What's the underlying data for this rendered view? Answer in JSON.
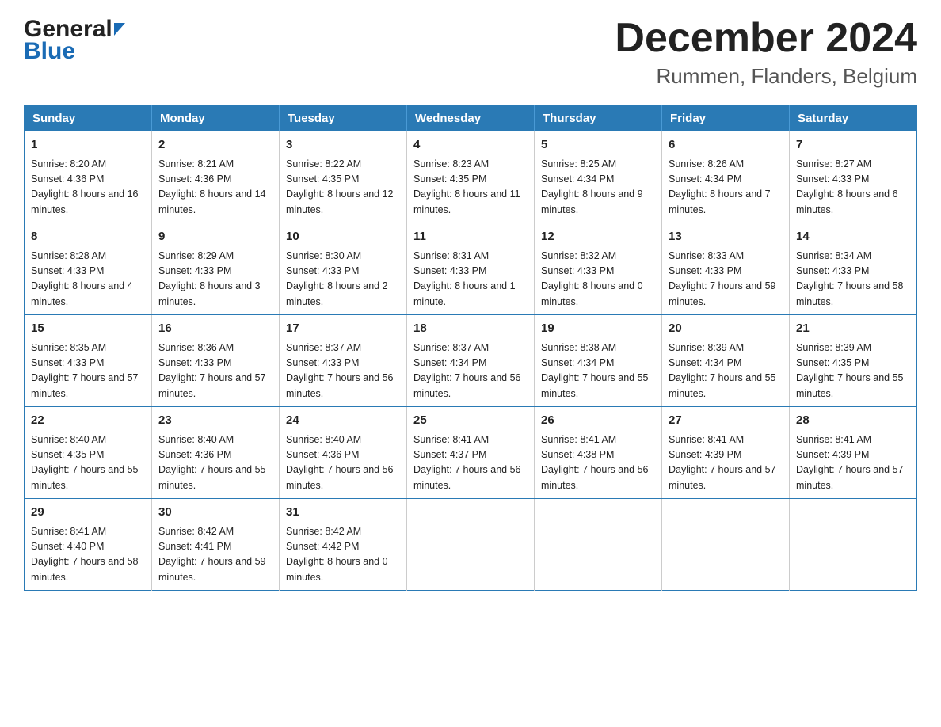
{
  "header": {
    "logo_general": "General",
    "logo_blue": "Blue",
    "month_title": "December 2024",
    "location": "Rummen, Flanders, Belgium"
  },
  "columns": [
    "Sunday",
    "Monday",
    "Tuesday",
    "Wednesday",
    "Thursday",
    "Friday",
    "Saturday"
  ],
  "weeks": [
    [
      {
        "day": "1",
        "sunrise": "8:20 AM",
        "sunset": "4:36 PM",
        "daylight": "8 hours and 16 minutes."
      },
      {
        "day": "2",
        "sunrise": "8:21 AM",
        "sunset": "4:36 PM",
        "daylight": "8 hours and 14 minutes."
      },
      {
        "day": "3",
        "sunrise": "8:22 AM",
        "sunset": "4:35 PM",
        "daylight": "8 hours and 12 minutes."
      },
      {
        "day": "4",
        "sunrise": "8:23 AM",
        "sunset": "4:35 PM",
        "daylight": "8 hours and 11 minutes."
      },
      {
        "day": "5",
        "sunrise": "8:25 AM",
        "sunset": "4:34 PM",
        "daylight": "8 hours and 9 minutes."
      },
      {
        "day": "6",
        "sunrise": "8:26 AM",
        "sunset": "4:34 PM",
        "daylight": "8 hours and 7 minutes."
      },
      {
        "day": "7",
        "sunrise": "8:27 AM",
        "sunset": "4:33 PM",
        "daylight": "8 hours and 6 minutes."
      }
    ],
    [
      {
        "day": "8",
        "sunrise": "8:28 AM",
        "sunset": "4:33 PM",
        "daylight": "8 hours and 4 minutes."
      },
      {
        "day": "9",
        "sunrise": "8:29 AM",
        "sunset": "4:33 PM",
        "daylight": "8 hours and 3 minutes."
      },
      {
        "day": "10",
        "sunrise": "8:30 AM",
        "sunset": "4:33 PM",
        "daylight": "8 hours and 2 minutes."
      },
      {
        "day": "11",
        "sunrise": "8:31 AM",
        "sunset": "4:33 PM",
        "daylight": "8 hours and 1 minute."
      },
      {
        "day": "12",
        "sunrise": "8:32 AM",
        "sunset": "4:33 PM",
        "daylight": "8 hours and 0 minutes."
      },
      {
        "day": "13",
        "sunrise": "8:33 AM",
        "sunset": "4:33 PM",
        "daylight": "7 hours and 59 minutes."
      },
      {
        "day": "14",
        "sunrise": "8:34 AM",
        "sunset": "4:33 PM",
        "daylight": "7 hours and 58 minutes."
      }
    ],
    [
      {
        "day": "15",
        "sunrise": "8:35 AM",
        "sunset": "4:33 PM",
        "daylight": "7 hours and 57 minutes."
      },
      {
        "day": "16",
        "sunrise": "8:36 AM",
        "sunset": "4:33 PM",
        "daylight": "7 hours and 57 minutes."
      },
      {
        "day": "17",
        "sunrise": "8:37 AM",
        "sunset": "4:33 PM",
        "daylight": "7 hours and 56 minutes."
      },
      {
        "day": "18",
        "sunrise": "8:37 AM",
        "sunset": "4:34 PM",
        "daylight": "7 hours and 56 minutes."
      },
      {
        "day": "19",
        "sunrise": "8:38 AM",
        "sunset": "4:34 PM",
        "daylight": "7 hours and 55 minutes."
      },
      {
        "day": "20",
        "sunrise": "8:39 AM",
        "sunset": "4:34 PM",
        "daylight": "7 hours and 55 minutes."
      },
      {
        "day": "21",
        "sunrise": "8:39 AM",
        "sunset": "4:35 PM",
        "daylight": "7 hours and 55 minutes."
      }
    ],
    [
      {
        "day": "22",
        "sunrise": "8:40 AM",
        "sunset": "4:35 PM",
        "daylight": "7 hours and 55 minutes."
      },
      {
        "day": "23",
        "sunrise": "8:40 AM",
        "sunset": "4:36 PM",
        "daylight": "7 hours and 55 minutes."
      },
      {
        "day": "24",
        "sunrise": "8:40 AM",
        "sunset": "4:36 PM",
        "daylight": "7 hours and 56 minutes."
      },
      {
        "day": "25",
        "sunrise": "8:41 AM",
        "sunset": "4:37 PM",
        "daylight": "7 hours and 56 minutes."
      },
      {
        "day": "26",
        "sunrise": "8:41 AM",
        "sunset": "4:38 PM",
        "daylight": "7 hours and 56 minutes."
      },
      {
        "day": "27",
        "sunrise": "8:41 AM",
        "sunset": "4:39 PM",
        "daylight": "7 hours and 57 minutes."
      },
      {
        "day": "28",
        "sunrise": "8:41 AM",
        "sunset": "4:39 PM",
        "daylight": "7 hours and 57 minutes."
      }
    ],
    [
      {
        "day": "29",
        "sunrise": "8:41 AM",
        "sunset": "4:40 PM",
        "daylight": "7 hours and 58 minutes."
      },
      {
        "day": "30",
        "sunrise": "8:42 AM",
        "sunset": "4:41 PM",
        "daylight": "7 hours and 59 minutes."
      },
      {
        "day": "31",
        "sunrise": "8:42 AM",
        "sunset": "4:42 PM",
        "daylight": "8 hours and 0 minutes."
      },
      null,
      null,
      null,
      null
    ]
  ],
  "labels": {
    "sunrise": "Sunrise:",
    "sunset": "Sunset:",
    "daylight": "Daylight:"
  }
}
